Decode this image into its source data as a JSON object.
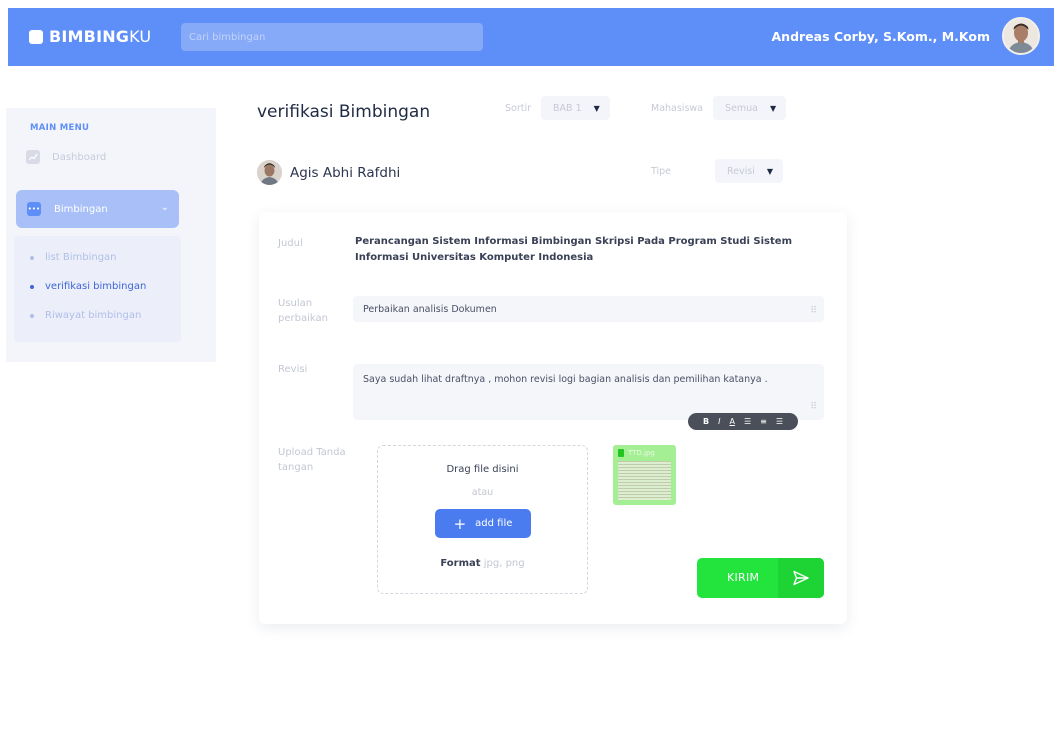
{
  "header": {
    "brand_bold": "BIMBING",
    "brand_light": "KU",
    "search_placeholder": "Cari bimbingan",
    "user_name": "Andreas Corby, S.Kom., M.Kom"
  },
  "sidebar": {
    "menu_title": "MAIN MENU",
    "dashboard_label": "Dashboard",
    "bimbingan_label": "Bimbingan",
    "items": [
      {
        "label": "list Bimbingan",
        "active": false
      },
      {
        "label": "verifikasi bimbingan",
        "active": true
      },
      {
        "label": "Riwayat bimbingan",
        "active": false
      }
    ]
  },
  "main": {
    "title": "verifikasi Bimbingan",
    "sortir_label": "Sortir",
    "sortir_value": "BAB 1",
    "mahasiswa_label": "Mahasiswa",
    "mahasiswa_value": "Semua",
    "tipe_label": "Tipe",
    "tipe_value": "Revisi",
    "student_name": "Agis Abhi Rafdhi"
  },
  "form": {
    "judul_label": "Judul",
    "judul_value": "Perancangan Sistem Informasi Bimbingan Skripsi Pada Program Studi Sistem Informasi Universitas Komputer Indonesia",
    "usulan_label": "Usulan perbaikan",
    "usulan_value": "Perbaikan analisis Dokumen",
    "revisi_label": "Revisi",
    "revisi_value": "Saya sudah lihat draftnya , mohon revisi logi bagian analisis dan pemilihan katanya .",
    "upload_label": "Upload Tanda tangan",
    "drop_title": "Drag file disini",
    "drop_or": "atau",
    "add_file_label": "add file",
    "format_label": "Format",
    "format_value": "jpg, png",
    "thumb_name": "TTD.jpg",
    "send_label": "KIRIM",
    "toolbar": {
      "bold": "B",
      "italic": "I",
      "underline": "A"
    }
  },
  "colors": {
    "primary": "#5e8ef7",
    "send_green": "#22e43d",
    "thumb_green": "#a4ef94"
  }
}
